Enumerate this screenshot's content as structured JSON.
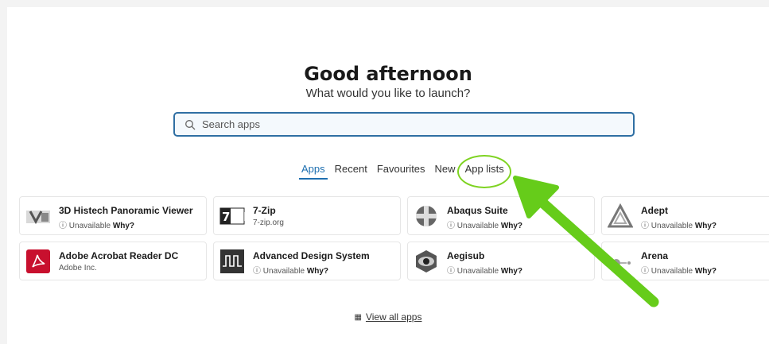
{
  "greeting": "Good afternoon",
  "subtitle": "What would you like to launch?",
  "search": {
    "placeholder": "Search apps"
  },
  "tabs": [
    {
      "label": "Apps",
      "active": true
    },
    {
      "label": "Recent"
    },
    {
      "label": "Favourites"
    },
    {
      "label": "New"
    },
    {
      "label": "App lists",
      "highlighted": true
    }
  ],
  "apps": [
    {
      "name": "3D Histech Panoramic Viewer",
      "status": "Unavailable",
      "why": "Why?"
    },
    {
      "name": "7-Zip",
      "subtitle": "7-zip.org"
    },
    {
      "name": "Abaqus Suite",
      "status": "Unavailable",
      "why": "Why?"
    },
    {
      "name": "Adept",
      "status": "Unavailable",
      "why": "Why?"
    },
    {
      "name": "Adobe Acrobat Reader DC",
      "subtitle": "Adobe Inc."
    },
    {
      "name": "Advanced Design System",
      "status": "Unavailable",
      "why": "Why?"
    },
    {
      "name": "Aegisub",
      "status": "Unavailable",
      "why": "Why?"
    },
    {
      "name": "Arena",
      "status": "Unavailable",
      "why": "Why?"
    }
  ],
  "view_all": "View all apps",
  "logo_texts": {
    "zip_mark": "7ZIP"
  },
  "colors": {
    "accent": "#1e6fb0",
    "highlight": "#7ed321",
    "acrobat": "#c8102e"
  }
}
